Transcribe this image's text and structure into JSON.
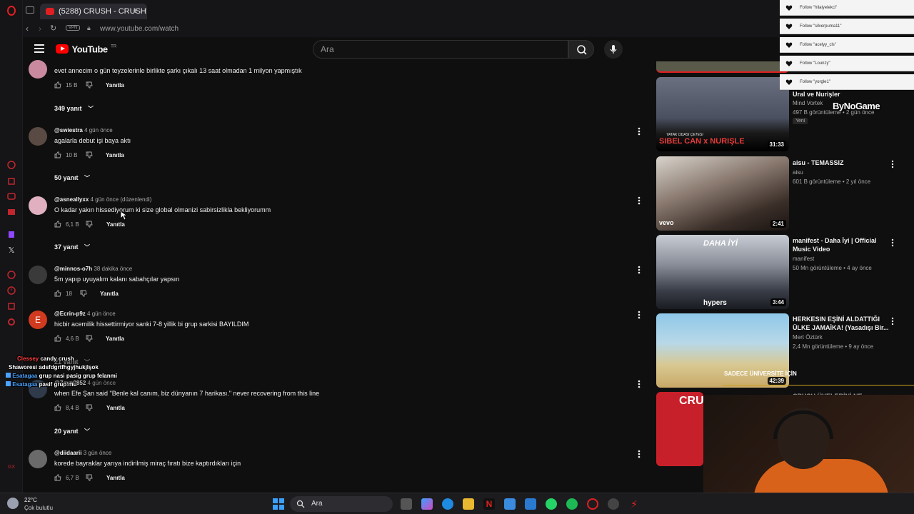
{
  "browser": {
    "tab_title": "(5288) CRUSH - CRUSH! | ...",
    "url": "www.youtube.com/watch",
    "vpn_label": "VPN",
    "sidebar_bottom_label": "GX"
  },
  "youtube": {
    "logo_text": "YouTube",
    "logo_region": "TR",
    "search_placeholder": "Ara"
  },
  "comments": [
    {
      "user": "",
      "time": "",
      "text": "evet annecim o gün teyzelerinle birlikte şarkı çıkalı 13 saat olmadan 1 milyon yapmıştık",
      "likes": "15 B",
      "reply": "Yanıtla",
      "replies": "349 yanıt",
      "avatar_color": "#c98aa0"
    },
    {
      "user": "@swiestra",
      "time": "4 gün önce",
      "text": "agalarla debut işi baya aktı",
      "likes": "10 B",
      "reply": "Yanıtla",
      "replies": "50 yanıt",
      "avatar_color": "#5a4a44"
    },
    {
      "user": "@asneallyxx",
      "time": "4 gün önce (düzenlendi)",
      "text": "O kadar yakın hissediyorum ki size global olmanizi sabirsizlikla bekliyorumm",
      "likes": "6,1 B",
      "reply": "Yanıtla",
      "replies": "37 yanıt",
      "avatar_color": "#e0b0c0"
    },
    {
      "user": "@minnos-o7h",
      "time": "38 dakika önce",
      "text": "5m yapıp uyuyalım kalanı sabahçılar yapsın",
      "likes": "18",
      "reply": "Yanıtla",
      "replies": "",
      "avatar_color": "#3a3a3a"
    },
    {
      "user": "@Ecrin-p9z",
      "time": "4 gün önce",
      "text": "hicbir acemilik hissettirmiyor sanki 7-8 yillik bi grup sarkisi BAYILDIM",
      "likes": "4,6 B",
      "reply": "Yanıtla",
      "replies": "21 yanıt",
      "avatar_color": "#d03a1e",
      "avatar_letter": "E"
    },
    {
      "user": "@Zeyn0852",
      "time": "4 gün önce",
      "text": "when Efe Şan said \"Benle kal canım, biz dünyanın 7 harikası.\" never recovering from this line",
      "likes": "8,4 B",
      "reply": "Yanıtla",
      "replies": "20 yanıt",
      "avatar_color": "#2f3a4a"
    },
    {
      "user": "@diidaarii",
      "time": "3 gün önce",
      "text": "korede bayraklar yarıya indirilmiş miraç fıratı bize kaptırdıkları için",
      "likes": "6,7 B",
      "reply": "Yanıtla",
      "replies": "",
      "avatar_color": "#6a6a6a"
    }
  ],
  "sidebar_videos": [
    {
      "title": "Ural ve Nurişler",
      "channel": "Mind Vortek",
      "stats": "497 B görüntüleme • 2 gün önce",
      "duration": "31:33",
      "badge": "Yeni",
      "thumb_text": "SIBEL CAN x NURIŞLE",
      "thumb_caption": "YATAK ODASI ÇETESI"
    },
    {
      "title": "aisu - TEMASSIZ",
      "channel": "aisu",
      "stats": "601 B görüntüleme • 2 yıl önce",
      "duration": "2:41",
      "badge": "",
      "thumb_text": "vevo",
      "thumb_caption": ""
    },
    {
      "title": "manifest - Daha İyi | Official Music Video",
      "channel": "manifest",
      "stats": "50 Mn görüntüleme • 4 ay önce",
      "duration": "3:44",
      "badge": "",
      "thumb_text": "DAHA İYİ",
      "thumb_caption": "hypers"
    },
    {
      "title": "HERKESIN EŞİNİ ALDATTIĞI ÜLKE JAMAİKA! (Yasadışı Bir...",
      "channel": "Mert Öztürk",
      "stats": "2,4 Mn görüntüleme • 9 ay önce",
      "duration": "42:39",
      "badge": "",
      "thumb_text": "SADECE ÜNİVERSİTE İÇİN",
      "thumb_caption": ""
    },
    {
      "title": "CRUSH ÜYELERİNİ NE KADAR...",
      "channel": "",
      "stats": "",
      "duration": "",
      "badge": "",
      "thumb_text": "CRU",
      "thumb_caption": ""
    }
  ],
  "stream_overlay": {
    "follows": [
      "Follow \"hilalyelekci\"",
      "Follow \"silverpuma11\"",
      "Follow \"acelyy_cls\"",
      "Follow \"Lounzy\"",
      "Follow \"yorgle1\""
    ],
    "watermark": "ByNoGame",
    "chat": [
      {
        "user": "Clessey",
        "msg": "candy crush",
        "color": "#ff4040"
      },
      {
        "user": "Shaworesi",
        "msg": "adsfdgrtfhgyjhukjlşok",
        "color": "#ffffff"
      },
      {
        "user": "Esatagaa",
        "msg": "grup nasi pasig grup felanmi",
        "color": "#4aa3ff"
      },
      {
        "user": "Esatagaa",
        "msg": "pasif grup mu",
        "color": "#4aa3ff"
      }
    ]
  },
  "taskbar": {
    "temperature": "22°C",
    "weather": "Çok bulutlu",
    "search_label": "Ara"
  },
  "colors": {
    "youtube_red": "#ff0000",
    "opera_red": "#e02020",
    "background": "#0f0f0f"
  }
}
